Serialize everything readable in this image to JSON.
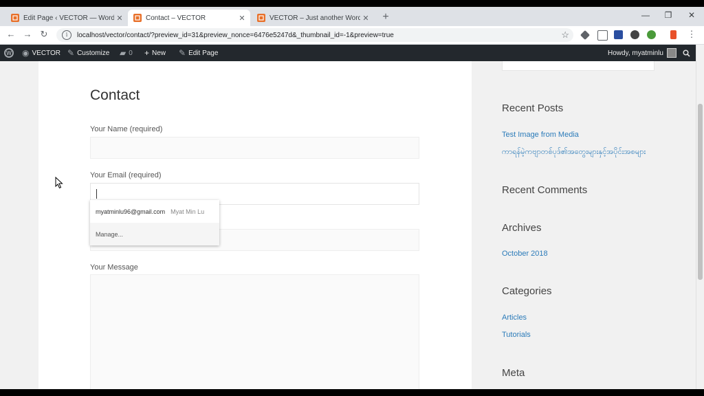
{
  "browser": {
    "tabs": [
      {
        "title": "Edit Page ‹ VECTOR — WordPress",
        "active": false
      },
      {
        "title": "Contact – VECTOR",
        "active": true
      },
      {
        "title": "VECTOR – Just another WordPress site",
        "active": false
      }
    ],
    "new_tab": "+",
    "url": "localhost/vector/contact/?preview_id=31&preview_nonce=6476e5247d&_thumbnail_id=-1&preview=true",
    "icons": [
      "back-icon",
      "forward-icon",
      "reload-icon",
      "info-icon",
      "star-icon",
      "close-icon",
      "minimize-icon",
      "maximize-icon"
    ]
  },
  "adminbar": {
    "site": "VECTOR",
    "customize": "Customize",
    "comments_count": "0",
    "new": "New",
    "edit_page": "Edit Page",
    "howdy": "Howdy, myatminlu"
  },
  "content": {
    "title": "Contact",
    "name_label": "Your Name (required)",
    "email_label": "Your Email (required)",
    "message_label": "Your Message",
    "autofill": {
      "email": "myatminlu96@gmail.com",
      "name": "Myat Min Lu",
      "manage": "Manage..."
    }
  },
  "sidebar": {
    "recent_posts_title": "Recent Posts",
    "recent_posts": [
      "Test Image from Media",
      "ကာရန်မဲ့ကဗျာတစ်ပုဒ်၏အတွေးများနှင့်အပိုင်းအစများ"
    ],
    "recent_comments_title": "Recent Comments",
    "archives_title": "Archives",
    "archives": [
      "October 2018"
    ],
    "categories_title": "Categories",
    "categories": [
      "Articles",
      "Tutorials"
    ],
    "meta_title": "Meta"
  },
  "colors": {
    "accent": "#2b7bb9",
    "adminbar": "#23282d",
    "favicon": "#e8702a"
  }
}
